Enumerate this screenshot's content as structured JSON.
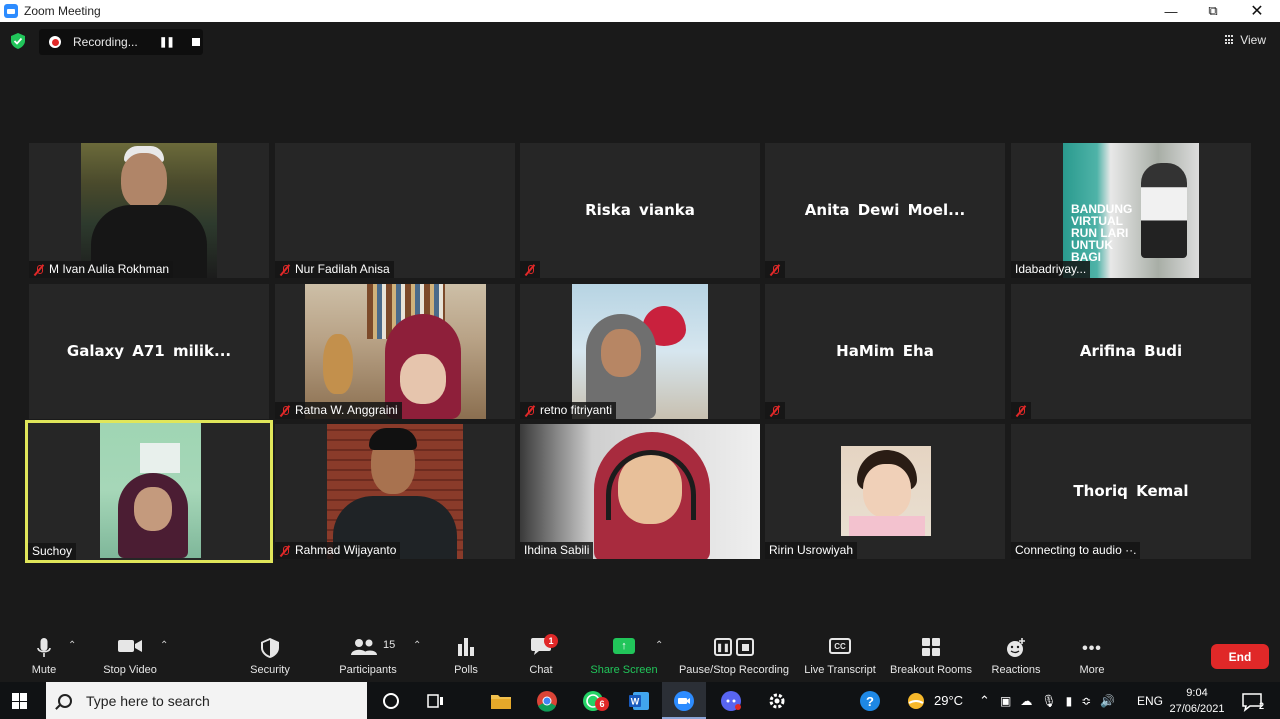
{
  "window": {
    "title": "Zoom Meeting",
    "controls": [
      "minimize",
      "restore",
      "close"
    ]
  },
  "meeting_header": {
    "recording_label": "Recording...",
    "view_label": "View"
  },
  "participants_tiles": [
    {
      "name": "M Ivan Aulia Rokhman",
      "muted": true,
      "video": true
    },
    {
      "name": "Nur Fadilah Anisa",
      "muted": true,
      "video": false
    },
    {
      "name": "Riska vianka",
      "muted": true,
      "video": false
    },
    {
      "name": "Anita  Dewi  Moel...",
      "muted": true,
      "video": false
    },
    {
      "name": "Idabadriyay...",
      "muted": false,
      "video": true
    },
    {
      "name": "Galaxy  A71  milik...",
      "muted": false,
      "video": false
    },
    {
      "name": "Ratna W. Anggraini",
      "muted": true,
      "video": true
    },
    {
      "name": "retno fitriyanti",
      "muted": true,
      "video": true
    },
    {
      "name": "HaMim Eha",
      "muted": true,
      "video": false
    },
    {
      "name": "Arifina Budi",
      "muted": true,
      "video": false
    },
    {
      "name": "Suchoy",
      "muted": false,
      "video": true,
      "active_speaker": true
    },
    {
      "name": "Rahmad Wijayanto",
      "muted": true,
      "video": true
    },
    {
      "name": "Ihdina Sabili",
      "muted": false,
      "video": true
    },
    {
      "name": "Ririn Usrowiyah",
      "muted": false,
      "video": true
    },
    {
      "name": "Thoriq Kemal",
      "muted": false,
      "video": false,
      "status": "Connecting to audio ··."
    }
  ],
  "ida_poster_text": "BANDUNG VIRTUAL RUN LARI UNTUK BAGI",
  "toolbar": {
    "mute": "Mute",
    "stop_video": "Stop Video",
    "security": "Security",
    "participants": "Participants",
    "participants_count": "15",
    "polls": "Polls",
    "chat": "Chat",
    "chat_badge": "1",
    "share_screen": "Share Screen",
    "pause_stop_recording": "Pause/Stop Recording",
    "live_transcript": "Live Transcript",
    "cc": "CC",
    "breakout_rooms": "Breakout Rooms",
    "reactions": "Reactions",
    "more": "More",
    "end": "End"
  },
  "taskbar": {
    "search_placeholder": "Type here to search",
    "whatsapp_badge": "6",
    "temperature": "29°C",
    "language": "ENG",
    "time": "9:04",
    "date": "27/06/2021",
    "notification_count": "2"
  },
  "colors": {
    "active_speaker_border": "#e0e65a",
    "end_button": "#e02828",
    "share_green": "#21c55a",
    "muted_red": "#e02828"
  }
}
